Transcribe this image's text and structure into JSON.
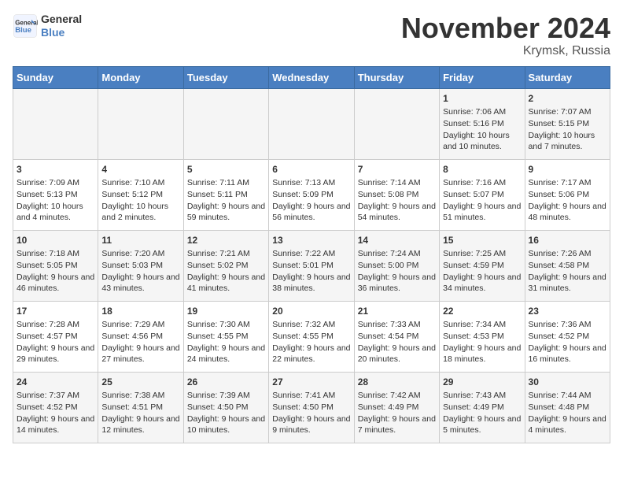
{
  "header": {
    "logo_line1": "General",
    "logo_line2": "Blue",
    "month": "November 2024",
    "location": "Krymsk, Russia"
  },
  "weekdays": [
    "Sunday",
    "Monday",
    "Tuesday",
    "Wednesday",
    "Thursday",
    "Friday",
    "Saturday"
  ],
  "weeks": [
    [
      {
        "day": "",
        "info": ""
      },
      {
        "day": "",
        "info": ""
      },
      {
        "day": "",
        "info": ""
      },
      {
        "day": "",
        "info": ""
      },
      {
        "day": "",
        "info": ""
      },
      {
        "day": "1",
        "info": "Sunrise: 7:06 AM\nSunset: 5:16 PM\nDaylight: 10 hours and 10 minutes."
      },
      {
        "day": "2",
        "info": "Sunrise: 7:07 AM\nSunset: 5:15 PM\nDaylight: 10 hours and 7 minutes."
      }
    ],
    [
      {
        "day": "3",
        "info": "Sunrise: 7:09 AM\nSunset: 5:13 PM\nDaylight: 10 hours and 4 minutes."
      },
      {
        "day": "4",
        "info": "Sunrise: 7:10 AM\nSunset: 5:12 PM\nDaylight: 10 hours and 2 minutes."
      },
      {
        "day": "5",
        "info": "Sunrise: 7:11 AM\nSunset: 5:11 PM\nDaylight: 9 hours and 59 minutes."
      },
      {
        "day": "6",
        "info": "Sunrise: 7:13 AM\nSunset: 5:09 PM\nDaylight: 9 hours and 56 minutes."
      },
      {
        "day": "7",
        "info": "Sunrise: 7:14 AM\nSunset: 5:08 PM\nDaylight: 9 hours and 54 minutes."
      },
      {
        "day": "8",
        "info": "Sunrise: 7:16 AM\nSunset: 5:07 PM\nDaylight: 9 hours and 51 minutes."
      },
      {
        "day": "9",
        "info": "Sunrise: 7:17 AM\nSunset: 5:06 PM\nDaylight: 9 hours and 48 minutes."
      }
    ],
    [
      {
        "day": "10",
        "info": "Sunrise: 7:18 AM\nSunset: 5:05 PM\nDaylight: 9 hours and 46 minutes."
      },
      {
        "day": "11",
        "info": "Sunrise: 7:20 AM\nSunset: 5:03 PM\nDaylight: 9 hours and 43 minutes."
      },
      {
        "day": "12",
        "info": "Sunrise: 7:21 AM\nSunset: 5:02 PM\nDaylight: 9 hours and 41 minutes."
      },
      {
        "day": "13",
        "info": "Sunrise: 7:22 AM\nSunset: 5:01 PM\nDaylight: 9 hours and 38 minutes."
      },
      {
        "day": "14",
        "info": "Sunrise: 7:24 AM\nSunset: 5:00 PM\nDaylight: 9 hours and 36 minutes."
      },
      {
        "day": "15",
        "info": "Sunrise: 7:25 AM\nSunset: 4:59 PM\nDaylight: 9 hours and 34 minutes."
      },
      {
        "day": "16",
        "info": "Sunrise: 7:26 AM\nSunset: 4:58 PM\nDaylight: 9 hours and 31 minutes."
      }
    ],
    [
      {
        "day": "17",
        "info": "Sunrise: 7:28 AM\nSunset: 4:57 PM\nDaylight: 9 hours and 29 minutes."
      },
      {
        "day": "18",
        "info": "Sunrise: 7:29 AM\nSunset: 4:56 PM\nDaylight: 9 hours and 27 minutes."
      },
      {
        "day": "19",
        "info": "Sunrise: 7:30 AM\nSunset: 4:55 PM\nDaylight: 9 hours and 24 minutes."
      },
      {
        "day": "20",
        "info": "Sunrise: 7:32 AM\nSunset: 4:55 PM\nDaylight: 9 hours and 22 minutes."
      },
      {
        "day": "21",
        "info": "Sunrise: 7:33 AM\nSunset: 4:54 PM\nDaylight: 9 hours and 20 minutes."
      },
      {
        "day": "22",
        "info": "Sunrise: 7:34 AM\nSunset: 4:53 PM\nDaylight: 9 hours and 18 minutes."
      },
      {
        "day": "23",
        "info": "Sunrise: 7:36 AM\nSunset: 4:52 PM\nDaylight: 9 hours and 16 minutes."
      }
    ],
    [
      {
        "day": "24",
        "info": "Sunrise: 7:37 AM\nSunset: 4:52 PM\nDaylight: 9 hours and 14 minutes."
      },
      {
        "day": "25",
        "info": "Sunrise: 7:38 AM\nSunset: 4:51 PM\nDaylight: 9 hours and 12 minutes."
      },
      {
        "day": "26",
        "info": "Sunrise: 7:39 AM\nSunset: 4:50 PM\nDaylight: 9 hours and 10 minutes."
      },
      {
        "day": "27",
        "info": "Sunrise: 7:41 AM\nSunset: 4:50 PM\nDaylight: 9 hours and 9 minutes."
      },
      {
        "day": "28",
        "info": "Sunrise: 7:42 AM\nSunset: 4:49 PM\nDaylight: 9 hours and 7 minutes."
      },
      {
        "day": "29",
        "info": "Sunrise: 7:43 AM\nSunset: 4:49 PM\nDaylight: 9 hours and 5 minutes."
      },
      {
        "day": "30",
        "info": "Sunrise: 7:44 AM\nSunset: 4:48 PM\nDaylight: 9 hours and 4 minutes."
      }
    ]
  ]
}
